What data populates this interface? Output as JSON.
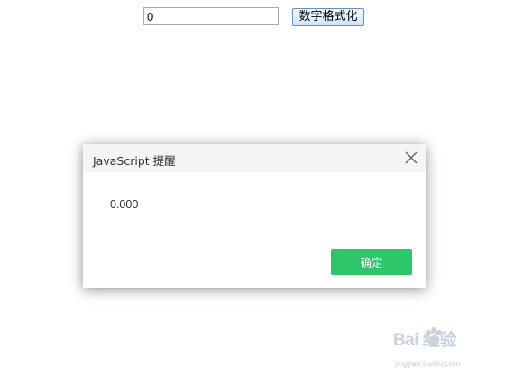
{
  "form": {
    "number_value": "0",
    "format_button_label": "数字格式化"
  },
  "dialog": {
    "title": "JavaScript 提醒",
    "message": "0.000",
    "ok_label": "确定",
    "close_icon": "close-icon"
  },
  "watermark": {
    "brand": "Bai  经验",
    "url": "jingyan.baidu.com"
  },
  "colors": {
    "ok_button": "#2ec66b",
    "dialog_header": "#f5f5f5",
    "text": "#333333"
  }
}
